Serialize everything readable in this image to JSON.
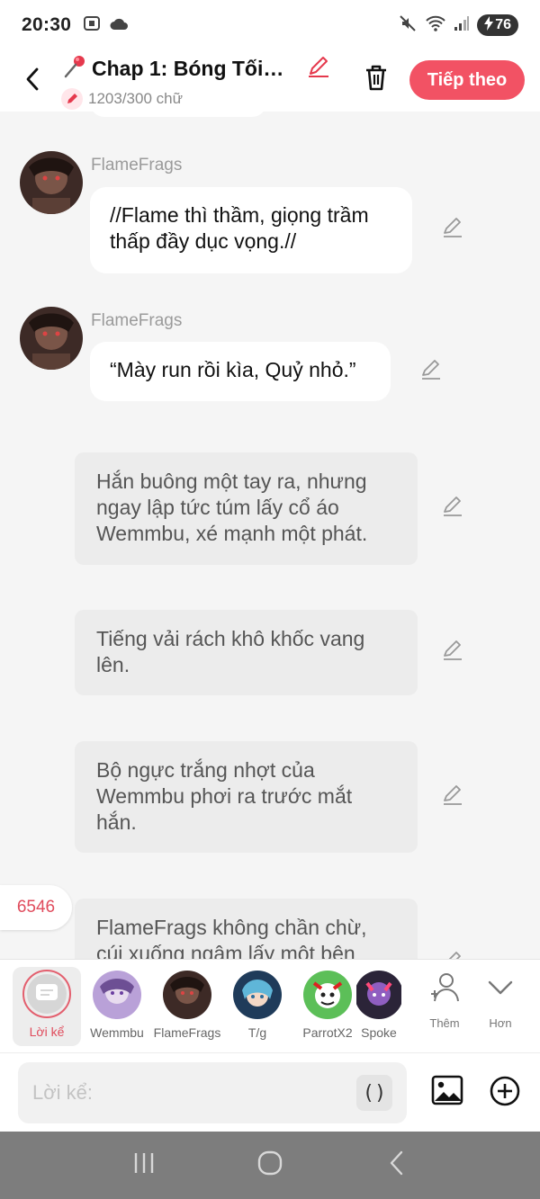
{
  "status_bar": {
    "time": "20:30",
    "battery": "76"
  },
  "header": {
    "title": "Chap 1: Bóng Tối T...",
    "word_count": "1203/300 chữ",
    "next_label": "Tiếp theo"
  },
  "messages": [
    {
      "type": "character",
      "sender": "FlameFrags",
      "text": "//Flame thì thầm, giọng trầm thấp đầy dục vọng.//"
    },
    {
      "type": "character",
      "sender": "FlameFrags",
      "text": "“Mày run rồi kìa, Quỷ nhỏ.”"
    },
    {
      "type": "narration",
      "text": "Hắn buông một tay ra, nhưng ngay lập tức túm lấy cổ áo Wemmbu, xé mạnh một phát."
    },
    {
      "type": "narration",
      "text": "Tiếng vải rách khô khốc vang lên."
    },
    {
      "type": "narration",
      "text": "Bộ ngực trắng nhợt của Wemmbu phơi ra trước mắt hắn."
    },
    {
      "type": "narration",
      "text": "FlameFrags không chần chừ, cúi xuống ngậm lấy một bên"
    }
  ],
  "side_counter": "6546",
  "characters": [
    {
      "label": "Lời kể",
      "active": true
    },
    {
      "label": "Wemmbu",
      "color": "#b9a1d8"
    },
    {
      "label": "FlameFrags",
      "color": "#6b4a3e"
    },
    {
      "label": "T/g",
      "color": "#5fb6d8"
    },
    {
      "label": "ParrotX2",
      "color": "#5cbf58"
    },
    {
      "label": "Spoke",
      "color": "#8f5ec0"
    }
  ],
  "tools": {
    "more_label": "Thêm",
    "collapse_label": "Hơn"
  },
  "composer": {
    "placeholder": "Lời kể:",
    "paren_label": "()"
  },
  "colors": {
    "accent": "#f25264",
    "narration_bubble": "#ececec",
    "character_bubble": "#ffffff",
    "background": "#f5f5f5"
  }
}
